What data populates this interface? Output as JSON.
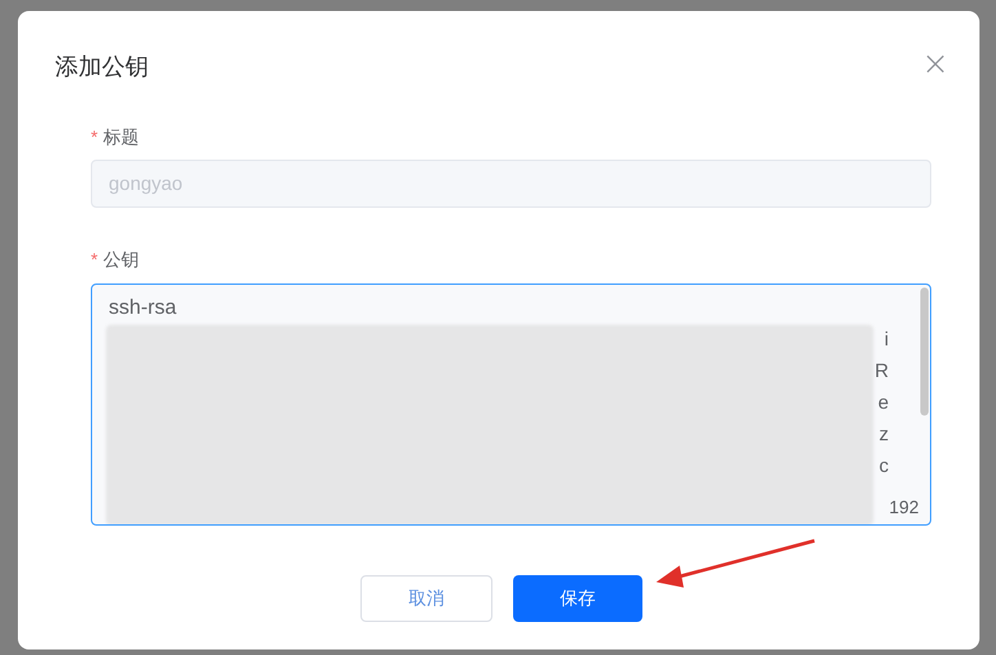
{
  "dialog": {
    "title": "添加公钥",
    "close": "×"
  },
  "fields": [
    {
      "kind": "input",
      "required_mark": "*",
      "label": "标题",
      "value": "gongyao",
      "disabled": true
    },
    {
      "kind": "textarea",
      "required_mark": "*",
      "label": "公钥",
      "focused": true,
      "first_line": "ssh-rsa",
      "rows": [
        {
          "end": "i"
        },
        {
          "end": "R"
        },
        {
          "end": "e"
        },
        {
          "end": "z"
        },
        {
          "end": "c"
        }
      ],
      "counter": "192"
    }
  ],
  "buttons": [
    {
      "label": "取消",
      "kind": "secondary"
    },
    {
      "label": "保存",
      "kind": "primary"
    }
  ]
}
